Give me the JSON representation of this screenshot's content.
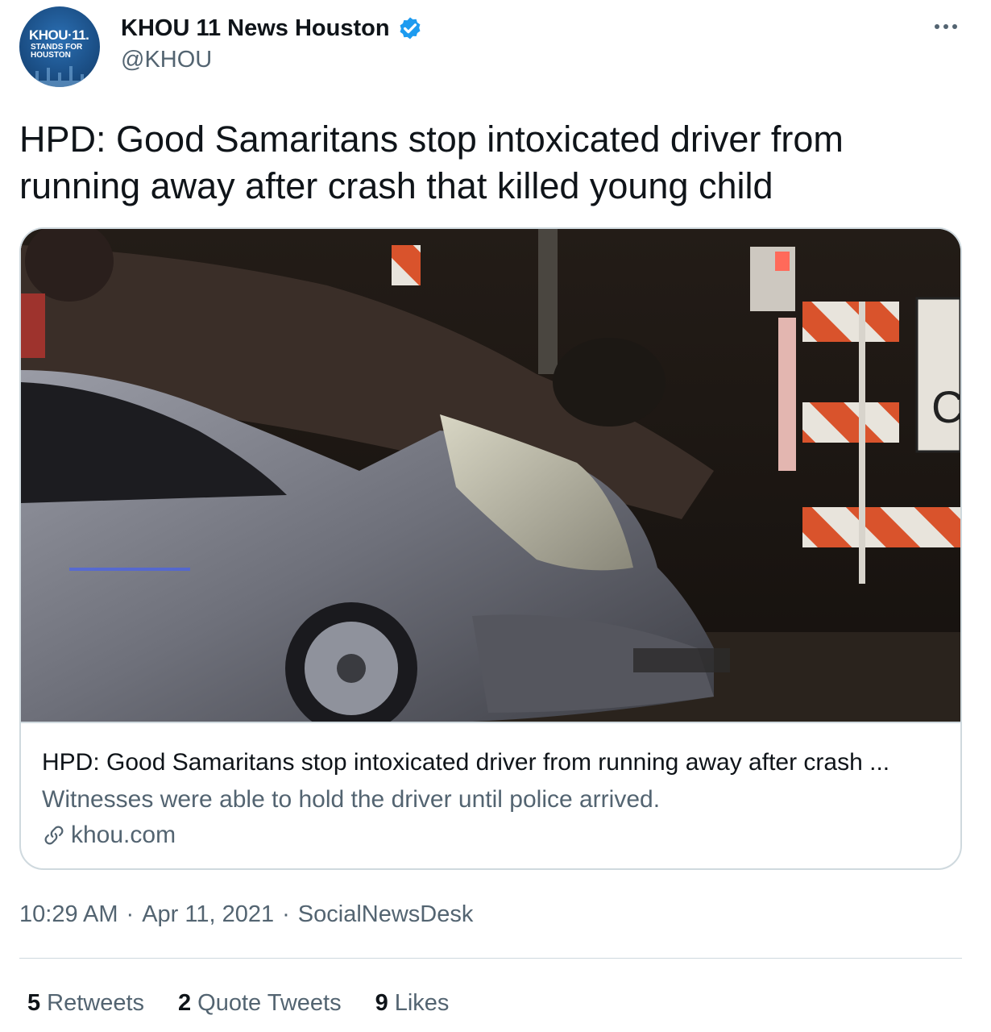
{
  "author": {
    "display_name": "KHOU 11 News Houston",
    "handle": "@KHOU",
    "avatar_text_main": "KHOU·11.",
    "avatar_text_sub_1": "STANDS FOR",
    "avatar_text_sub_2": "HOUSTON",
    "verified": true
  },
  "tweet": {
    "text": "HPD: Good Samaritans stop intoxicated driver from running away after crash that killed young child"
  },
  "card": {
    "image_alt": "night-time crash scene with overturned car and damaged silver sedan",
    "title": "HPD: Good Samaritans stop intoxicated driver from running away after crash ...",
    "description": "Witnesses were able to hold the driver until police arrived.",
    "domain": "khou.com"
  },
  "meta": {
    "time": "10:29 AM",
    "date": "Apr 11, 2021",
    "source": "SocialNewsDesk",
    "separator": "·"
  },
  "stats": {
    "retweets_count": "5",
    "retweets_label": "Retweets",
    "quotes_count": "2",
    "quotes_label": "Quote Tweets",
    "likes_count": "9",
    "likes_label": "Likes"
  },
  "colors": {
    "verified_blue": "#1d9bf0",
    "secondary_text": "#536471",
    "border": "#cfd9de"
  },
  "icons": {
    "more": "more-horizontal-icon",
    "verified": "verified-badge-icon",
    "link": "link-icon"
  }
}
